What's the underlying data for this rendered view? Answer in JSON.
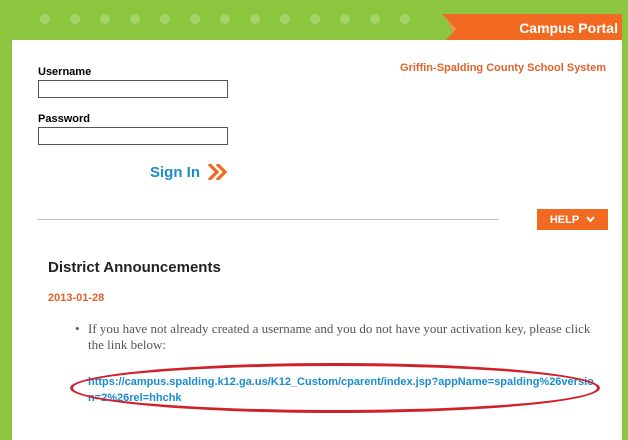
{
  "header": {
    "portal_title": "Campus Portal",
    "district_name": "Griffin-Spalding County School System"
  },
  "login": {
    "username_label": "Username",
    "username_value": "",
    "password_label": "Password",
    "password_value": "",
    "signin_label": "Sign In",
    "signin_icon": "double-chevron-right-icon"
  },
  "help": {
    "label": "HELP",
    "icon": "chevron-down-icon"
  },
  "announcements": {
    "title": "District Announcements",
    "date": "2013-01-28",
    "bullet": "•",
    "body": "If you have not already created a username and you do not have your activation key, please click the link below:",
    "link": "https://campus.spalding.k12.ga.us/K12_Custom/cparent/index.jsp?appName=spalding%26version=2%26rel=hhchk"
  },
  "colors": {
    "frame_green": "#8cc63f",
    "accent_orange": "#f26a21",
    "link_blue": "#1a8ccf",
    "highlight_red": "#d0202a"
  }
}
